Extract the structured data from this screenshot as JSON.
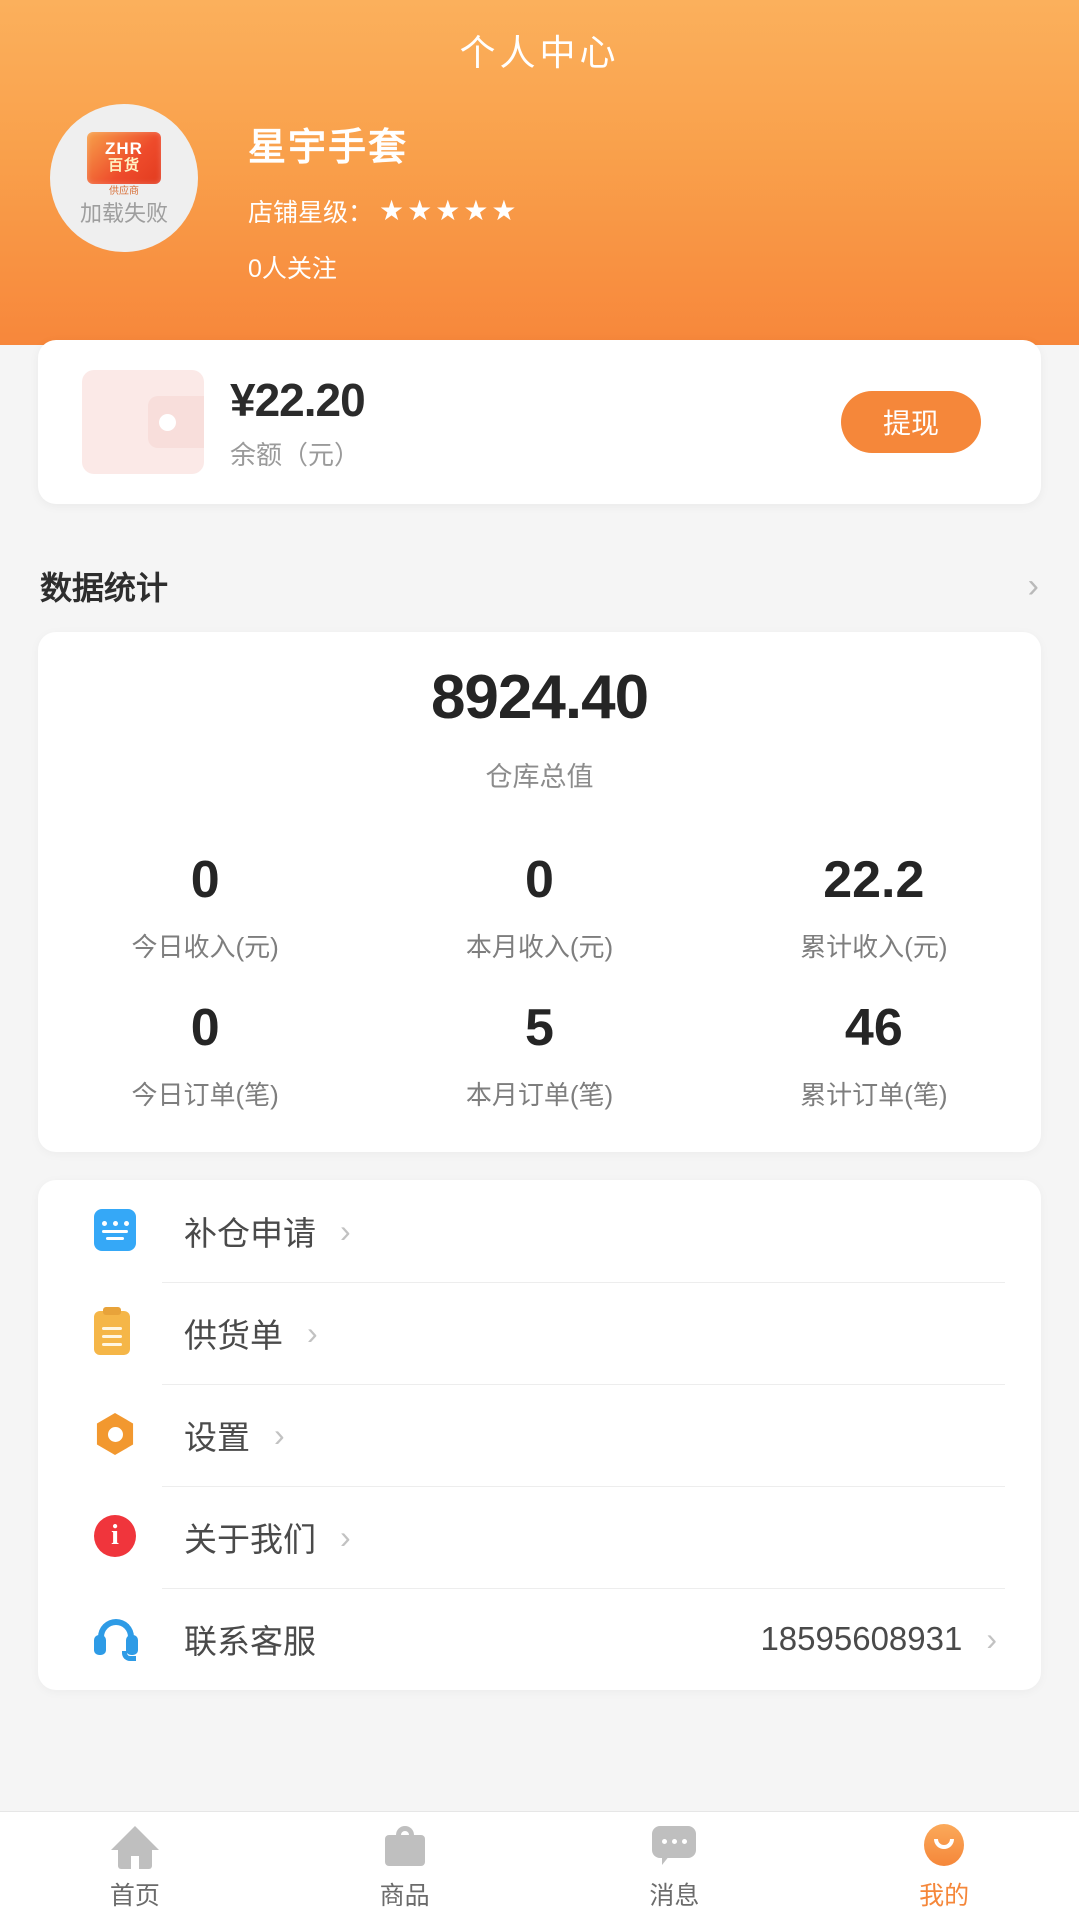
{
  "header": {
    "title": "个人中心",
    "avatar": {
      "logo_main": "ZHR",
      "logo_sub": "百货",
      "logo_tag": "供应商",
      "fail_text": "加载失败"
    },
    "shop_name": "星宇手套",
    "star_label": "店铺星级：",
    "stars": "★★★★★",
    "star_count": 5,
    "follow_text": "0人关注",
    "gradient_top": "#FBB05C",
    "gradient_bottom": "#F7873B"
  },
  "wallet": {
    "amount": "¥22.20",
    "label": "余额（元）",
    "withdraw_label": "提现",
    "button_color": "#F5873A"
  },
  "stats_section": {
    "title": "数据统计",
    "chevron": "›"
  },
  "stats": {
    "total_value": "8924.40",
    "total_label": "仓库总值",
    "cells": [
      {
        "value": "0",
        "label": "今日收入(元)"
      },
      {
        "value": "0",
        "label": "本月收入(元)"
      },
      {
        "value": "22.2",
        "label": "累计收入(元)"
      },
      {
        "value": "0",
        "label": "今日订单(笔)"
      },
      {
        "value": "5",
        "label": "本月订单(笔)"
      },
      {
        "value": "46",
        "label": "累计订单(笔)"
      }
    ]
  },
  "menu": {
    "items": [
      {
        "label": "补仓申请",
        "icon": "form-icon",
        "value": "",
        "chevron": "›"
      },
      {
        "label": "供货单",
        "icon": "clipboard-icon",
        "value": "",
        "chevron": "›"
      },
      {
        "label": "设置",
        "icon": "gear-icon",
        "value": "",
        "chevron": "›"
      },
      {
        "label": "关于我们",
        "icon": "info-icon",
        "value": "",
        "chevron": "›"
      },
      {
        "label": "联系客服",
        "icon": "headset-icon",
        "value": "18595608931",
        "chevron": "›"
      }
    ]
  },
  "tabbar": {
    "active_index": 3,
    "active_color": "#F5873A",
    "tabs": [
      {
        "label": "首页",
        "icon": "home-icon"
      },
      {
        "label": "商品",
        "icon": "bag-icon"
      },
      {
        "label": "消息",
        "icon": "chat-icon"
      },
      {
        "label": "我的",
        "icon": "profile-smiley-icon"
      }
    ]
  }
}
